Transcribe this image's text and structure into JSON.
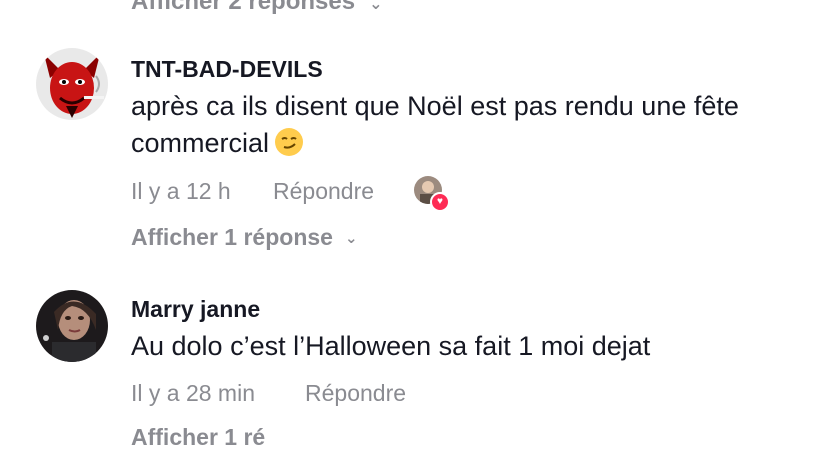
{
  "top_partial": {
    "more_label": "Afficher 2 réponses"
  },
  "comments": [
    {
      "username": "TNT-BAD-DEVILS",
      "text": "après ca ils disent que Noël est pas rendu une fête commercial",
      "emoji": "smirking-face",
      "time": "Il y a 12 h",
      "reply_label": "Répondre",
      "creator_liked": true,
      "more_label": "Afficher 1 réponse"
    },
    {
      "username": "Marry janne",
      "text": "Au dolo c’est l’Halloween sa fait 1 moi dejat",
      "time": "Il y a 28 min",
      "reply_label": "Répondre",
      "more_label": "Afficher 1 ré"
    }
  ],
  "colors": {
    "text": "#161823",
    "muted": "#8a8b91",
    "like_badge": "#fe2c55"
  }
}
